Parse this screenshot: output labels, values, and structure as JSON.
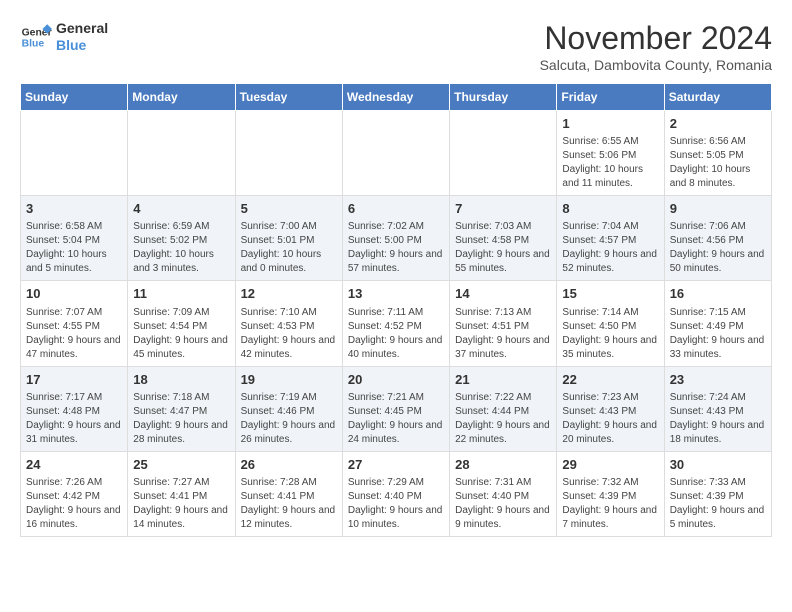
{
  "logo": {
    "line1": "General",
    "line2": "Blue"
  },
  "title": "November 2024",
  "subtitle": "Salcuta, Dambovita County, Romania",
  "days_of_week": [
    "Sunday",
    "Monday",
    "Tuesday",
    "Wednesday",
    "Thursday",
    "Friday",
    "Saturday"
  ],
  "weeks": [
    [
      {
        "day": "",
        "info": ""
      },
      {
        "day": "",
        "info": ""
      },
      {
        "day": "",
        "info": ""
      },
      {
        "day": "",
        "info": ""
      },
      {
        "day": "",
        "info": ""
      },
      {
        "day": "1",
        "info": "Sunrise: 6:55 AM\nSunset: 5:06 PM\nDaylight: 10 hours and 11 minutes."
      },
      {
        "day": "2",
        "info": "Sunrise: 6:56 AM\nSunset: 5:05 PM\nDaylight: 10 hours and 8 minutes."
      }
    ],
    [
      {
        "day": "3",
        "info": "Sunrise: 6:58 AM\nSunset: 5:04 PM\nDaylight: 10 hours and 5 minutes."
      },
      {
        "day": "4",
        "info": "Sunrise: 6:59 AM\nSunset: 5:02 PM\nDaylight: 10 hours and 3 minutes."
      },
      {
        "day": "5",
        "info": "Sunrise: 7:00 AM\nSunset: 5:01 PM\nDaylight: 10 hours and 0 minutes."
      },
      {
        "day": "6",
        "info": "Sunrise: 7:02 AM\nSunset: 5:00 PM\nDaylight: 9 hours and 57 minutes."
      },
      {
        "day": "7",
        "info": "Sunrise: 7:03 AM\nSunset: 4:58 PM\nDaylight: 9 hours and 55 minutes."
      },
      {
        "day": "8",
        "info": "Sunrise: 7:04 AM\nSunset: 4:57 PM\nDaylight: 9 hours and 52 minutes."
      },
      {
        "day": "9",
        "info": "Sunrise: 7:06 AM\nSunset: 4:56 PM\nDaylight: 9 hours and 50 minutes."
      }
    ],
    [
      {
        "day": "10",
        "info": "Sunrise: 7:07 AM\nSunset: 4:55 PM\nDaylight: 9 hours and 47 minutes."
      },
      {
        "day": "11",
        "info": "Sunrise: 7:09 AM\nSunset: 4:54 PM\nDaylight: 9 hours and 45 minutes."
      },
      {
        "day": "12",
        "info": "Sunrise: 7:10 AM\nSunset: 4:53 PM\nDaylight: 9 hours and 42 minutes."
      },
      {
        "day": "13",
        "info": "Sunrise: 7:11 AM\nSunset: 4:52 PM\nDaylight: 9 hours and 40 minutes."
      },
      {
        "day": "14",
        "info": "Sunrise: 7:13 AM\nSunset: 4:51 PM\nDaylight: 9 hours and 37 minutes."
      },
      {
        "day": "15",
        "info": "Sunrise: 7:14 AM\nSunset: 4:50 PM\nDaylight: 9 hours and 35 minutes."
      },
      {
        "day": "16",
        "info": "Sunrise: 7:15 AM\nSunset: 4:49 PM\nDaylight: 9 hours and 33 minutes."
      }
    ],
    [
      {
        "day": "17",
        "info": "Sunrise: 7:17 AM\nSunset: 4:48 PM\nDaylight: 9 hours and 31 minutes."
      },
      {
        "day": "18",
        "info": "Sunrise: 7:18 AM\nSunset: 4:47 PM\nDaylight: 9 hours and 28 minutes."
      },
      {
        "day": "19",
        "info": "Sunrise: 7:19 AM\nSunset: 4:46 PM\nDaylight: 9 hours and 26 minutes."
      },
      {
        "day": "20",
        "info": "Sunrise: 7:21 AM\nSunset: 4:45 PM\nDaylight: 9 hours and 24 minutes."
      },
      {
        "day": "21",
        "info": "Sunrise: 7:22 AM\nSunset: 4:44 PM\nDaylight: 9 hours and 22 minutes."
      },
      {
        "day": "22",
        "info": "Sunrise: 7:23 AM\nSunset: 4:43 PM\nDaylight: 9 hours and 20 minutes."
      },
      {
        "day": "23",
        "info": "Sunrise: 7:24 AM\nSunset: 4:43 PM\nDaylight: 9 hours and 18 minutes."
      }
    ],
    [
      {
        "day": "24",
        "info": "Sunrise: 7:26 AM\nSunset: 4:42 PM\nDaylight: 9 hours and 16 minutes."
      },
      {
        "day": "25",
        "info": "Sunrise: 7:27 AM\nSunset: 4:41 PM\nDaylight: 9 hours and 14 minutes."
      },
      {
        "day": "26",
        "info": "Sunrise: 7:28 AM\nSunset: 4:41 PM\nDaylight: 9 hours and 12 minutes."
      },
      {
        "day": "27",
        "info": "Sunrise: 7:29 AM\nSunset: 4:40 PM\nDaylight: 9 hours and 10 minutes."
      },
      {
        "day": "28",
        "info": "Sunrise: 7:31 AM\nSunset: 4:40 PM\nDaylight: 9 hours and 9 minutes."
      },
      {
        "day": "29",
        "info": "Sunrise: 7:32 AM\nSunset: 4:39 PM\nDaylight: 9 hours and 7 minutes."
      },
      {
        "day": "30",
        "info": "Sunrise: 7:33 AM\nSunset: 4:39 PM\nDaylight: 9 hours and 5 minutes."
      }
    ]
  ]
}
